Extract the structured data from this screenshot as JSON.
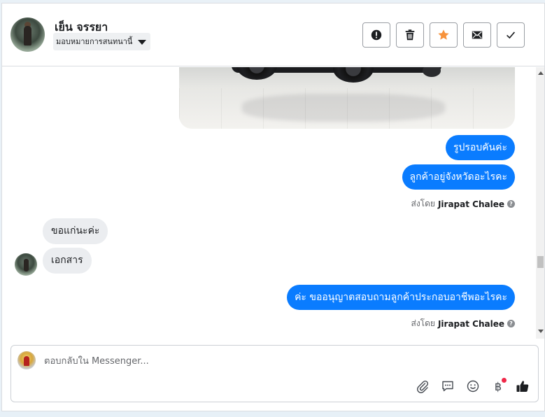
{
  "header": {
    "contact_name": "เย็น จรรยา",
    "assign_label": "มอบหมายการสนทนานี้",
    "actions": [
      {
        "name": "report",
        "icon": "exclamation-icon"
      },
      {
        "name": "delete",
        "icon": "trash-icon"
      },
      {
        "name": "star",
        "icon": "star-icon",
        "color": "#f7923b"
      },
      {
        "name": "mark-unread",
        "icon": "envelope-icon"
      },
      {
        "name": "done",
        "icon": "check-icon"
      }
    ]
  },
  "messages": {
    "out_1": "รูปรอบคันค่ะ",
    "out_2": "ลูกค้าอยู่จังหวัดอะไรคะ",
    "sent_by_1_prefix": "ส่งโดย",
    "sent_by_1_name": "Jirapat Chalee",
    "in_1": "ขอแก่นะค่ะ",
    "in_2": "เอกสาร",
    "out_3": "ค่ะ ขออนุญาตสอบถามลูกค้าประกอบอาชีพอะไรคะ",
    "sent_by_2_prefix": "ส่งโดย",
    "sent_by_2_name": "Jirapat Chalee"
  },
  "composer": {
    "placeholder": "ตอบกลับใน Messenger...",
    "tools": [
      "paperclip-icon",
      "speech-bubble-icon",
      "smiley-icon",
      "baht-icon",
      "thumbs-up-icon"
    ],
    "baht_symbol": "฿"
  },
  "colors": {
    "outgoing_bubble": "#0a7cff",
    "incoming_bubble": "#ebedf0",
    "star": "#f7923b",
    "notification_dot": "#f02849"
  }
}
